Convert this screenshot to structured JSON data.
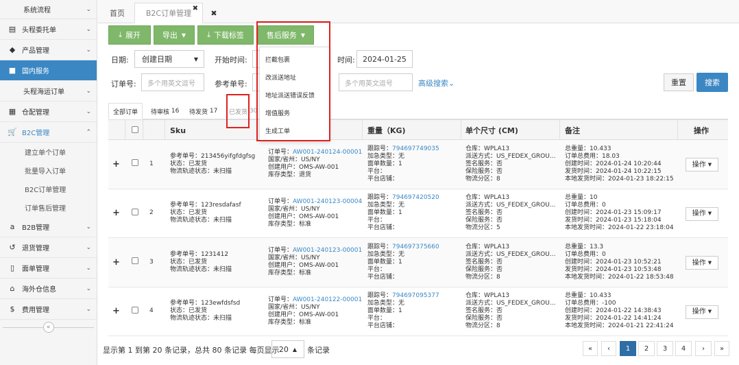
{
  "sidebar": {
    "items": [
      {
        "label": "系统流程",
        "icon": "none"
      },
      {
        "label": "头程委托单",
        "icon": "briefcase-icon"
      },
      {
        "label": "产品管理",
        "icon": "tag-icon"
      },
      {
        "label": "国内服务",
        "icon": "folder-icon"
      },
      {
        "label": "头程海运订单",
        "icon": "none"
      },
      {
        "label": "仓配管理",
        "icon": "grid-icon"
      },
      {
        "label": "B2C管理",
        "icon": "cart-icon"
      }
    ],
    "sub_items": [
      "建立单个订单",
      "批量导入订单",
      "B2C订单管理",
      "订单售后管理"
    ],
    "items2": [
      {
        "label": "B2B管理",
        "icon": "amazon-icon"
      },
      {
        "label": "退货管理",
        "icon": "return-icon"
      },
      {
        "label": "面单管理",
        "icon": "doc-icon"
      },
      {
        "label": "海外仓信息",
        "icon": "home-icon"
      },
      {
        "label": "费用管理",
        "icon": "dollar-icon"
      }
    ]
  },
  "tabs": {
    "home": "首页",
    "current": "B2C订单管理"
  },
  "toolbar": {
    "expand": "展开",
    "export": "导出",
    "download_label": "下载标签",
    "after_sales": "售后服务"
  },
  "dropdown": [
    "拦截包裹",
    "改派送地址",
    "地址派送错误反馈",
    "增值服务",
    "生成工单"
  ],
  "filters": {
    "date_label": "日期:",
    "date_type": "创建日期",
    "start_time_label": "开始时间:",
    "end_time_label": "时间:",
    "end_time": "2024-01-25",
    "order_no_label": "订单号:",
    "order_no_placeholder": "多个用英文逗号",
    "ref_no_label": "参考单号:",
    "tracking_placeholder": "多个用英文逗号",
    "advanced": "高级搜索",
    "reset": "重置",
    "search": "搜索"
  },
  "status_tabs": [
    {
      "label": "全部订单"
    },
    {
      "label": "待审核",
      "count": "16"
    },
    {
      "label": "待发货",
      "count": "17"
    },
    {
      "label": "已发货",
      "count": "30"
    }
  ],
  "table": {
    "headers": [
      "Sku",
      "重量（KG)",
      "单个尺寸 (CM)",
      "备注",
      "操作"
    ],
    "op_label": "操作",
    "rows": [
      {
        "num": "1",
        "sku": [
          "参考单号：213456yifgfdgfsg",
          "状态：已发货",
          "物流轨迹状态：未扫描"
        ],
        "order_no": "AW001-240124-00001",
        "order": [
          "国家/省州：US/NY",
          "创建用户：OMS-AW-001",
          "库存类型：退货"
        ],
        "tracking": "794697749035",
        "weight": [
          "加急类型：无",
          "面单数量：1",
          "平台：",
          "平台店铺："
        ],
        "size": [
          "仓库：WPLA13",
          "派送方式：US_FEDEX_GROU...",
          "签名服务：否",
          "保险服务：否",
          "物流分区：8"
        ],
        "remark": [
          "总重量：10.433",
          "订单总费用：18.03",
          "创建时间：2024-01-24 10:20:44",
          "发货时间：2024-01-24 10:22:15",
          "本地发货时间：2024-01-23 18:22:15"
        ]
      },
      {
        "num": "2",
        "sku": [
          "参考单号：123resdafasf",
          "状态：已发货",
          "物流轨迹状态：未扫描"
        ],
        "order_no": "AW001-240123-00004",
        "order": [
          "国家/省州：US/NY",
          "创建用户：OMS-AW-001",
          "库存类型：标准"
        ],
        "tracking": "794697420520",
        "weight": [
          "加急类型：无",
          "面单数量：1",
          "平台：",
          "平台店铺："
        ],
        "size": [
          "仓库：WPLA13",
          "派送方式：US_FEDEX_GROU...",
          "签名服务：否",
          "保险服务：否",
          "物流分区：5"
        ],
        "remark": [
          "总重量：10",
          "订单总费用：0",
          "创建时间：2024-01-23 15:09:17",
          "发货时间：2024-01-23 15:18:04",
          "本地发货时间：2024-01-22 23:18:04"
        ]
      },
      {
        "num": "3",
        "sku": [
          "参考单号：1231412",
          "状态：已发货",
          "物流轨迹状态：未扫描"
        ],
        "order_no": "AW001-240123-00001",
        "order": [
          "国家/省州：US/NY",
          "创建用户：OMS-AW-001",
          "库存类型：标准"
        ],
        "tracking": "794697375660",
        "weight": [
          "加急类型：无",
          "面单数量：1",
          "平台：",
          "平台店铺："
        ],
        "size": [
          "仓库：WPLA13",
          "派送方式：US_FEDEX_GROU...",
          "签名服务：否",
          "保险服务：否",
          "物流分区：8"
        ],
        "remark": [
          "总重量：13.3",
          "订单总费用：0",
          "创建时间：2024-01-23 10:52:21",
          "发货时间：2024-01-23 10:53:48",
          "本地发货时间：2024-01-22 18:53:48"
        ]
      },
      {
        "num": "4",
        "sku": [
          "参考单号：123ewfdsfsd",
          "状态：已发货",
          "物流轨迹状态：未扫描"
        ],
        "order_no": "AW001-240122-00001",
        "order": [
          "国家/省州：US/NY",
          "创建用户：OMS-AW-001",
          "库存类型：标准"
        ],
        "tracking": "794697095377",
        "weight": [
          "加急类型：无",
          "面单数量：1",
          "平台：",
          "平台店铺："
        ],
        "size": [
          "仓库：WPLA13",
          "派送方式：US_FEDEX_GROU...",
          "签名服务：否",
          "保险服务：否",
          "物流分区：8"
        ],
        "remark": [
          "总重量：10.433",
          "订单总费用：-100",
          "创建时间：2024-01-22 14:38:43",
          "发货时间：2024-01-22 14:41:24",
          "本地发货时间：2024-01-21 22:41:24"
        ]
      }
    ]
  },
  "labels": {
    "order_no": "订单号：",
    "tracking_no": "跟踪号："
  },
  "footer": {
    "summary": "显示第 1 到第 20 条记录，总共 80 条记录 每页显示",
    "page_size": "20",
    "records": "条记录",
    "pages": [
      "«",
      "‹",
      "1",
      "2",
      "3",
      "4",
      "›",
      "»"
    ]
  },
  "colors": {
    "accent": "#3a87c4",
    "green_button": "#7fb86a",
    "highlight": "#e02020"
  }
}
